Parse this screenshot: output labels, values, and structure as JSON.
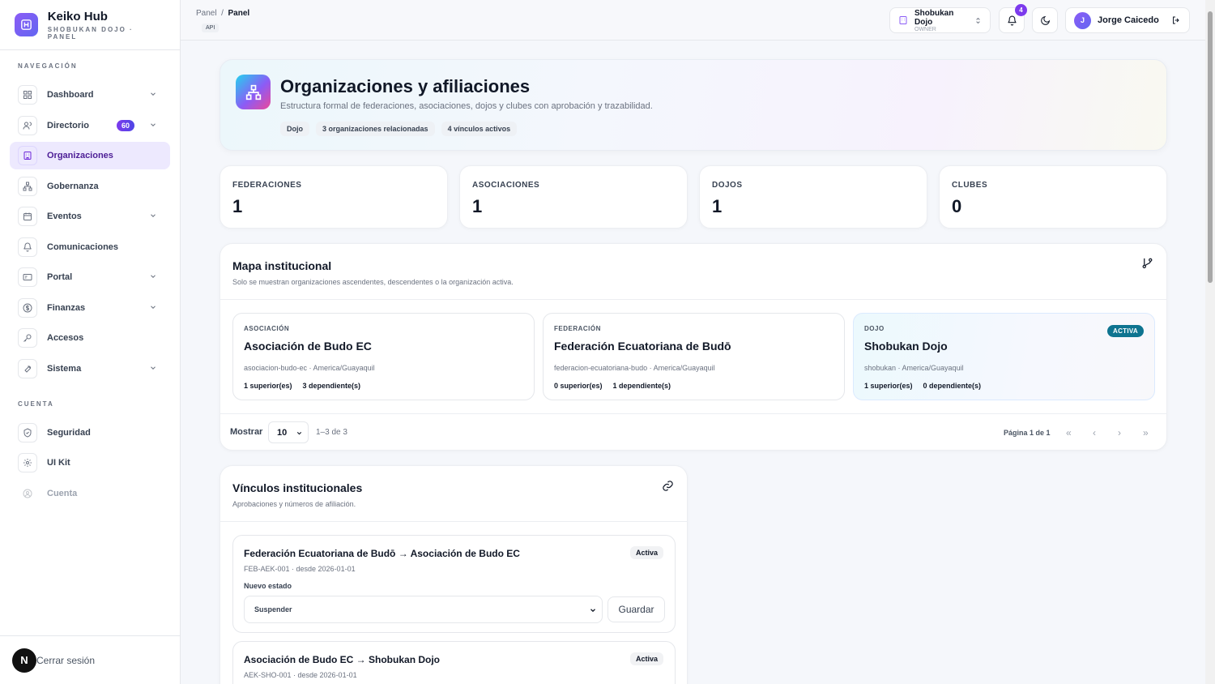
{
  "brand": {
    "title": "Keiko Hub",
    "subtitle": "SHOBUKAN DOJO · PANEL"
  },
  "sidebar": {
    "nav_label": "NAVEGACIÓN",
    "items": [
      {
        "label": "Dashboard",
        "icon": "grid-icon",
        "chevron": true
      },
      {
        "label": "Directorio",
        "icon": "users-icon",
        "chevron": true,
        "badge": "60"
      },
      {
        "label": "Organizaciones",
        "icon": "building-icon",
        "active": true
      },
      {
        "label": "Gobernanza",
        "icon": "network-icon"
      },
      {
        "label": "Eventos",
        "icon": "calendar-icon",
        "chevron": true
      },
      {
        "label": "Comunicaciones",
        "icon": "bell-icon"
      },
      {
        "label": "Portal",
        "icon": "card-icon",
        "chevron": true
      },
      {
        "label": "Finanzas",
        "icon": "dollar-icon",
        "chevron": true
      },
      {
        "label": "Accesos",
        "icon": "key-icon"
      },
      {
        "label": "Sistema",
        "icon": "wrench-icon",
        "chevron": true
      }
    ],
    "account_label": "CUENTA",
    "account_items": [
      {
        "label": "Seguridad",
        "icon": "shield-icon"
      },
      {
        "label": "UI Kit",
        "icon": "gear-icon"
      },
      {
        "label": "Cuenta",
        "icon": "user-circle-icon",
        "disabled": true
      }
    ],
    "logout": {
      "initial": "N",
      "label": "Cerrar sesión"
    }
  },
  "topbar": {
    "crumb_root": "Panel",
    "crumb_sep": "/",
    "crumb_current": "Panel",
    "api_tag": "API",
    "org_name": "Shobukan Dojo",
    "org_role": "OWNER",
    "notif_count": "4",
    "user_initial": "J",
    "user_name": "Jorge Caicedo"
  },
  "hero": {
    "title": "Organizaciones y afiliaciones",
    "description": "Estructura formal de federaciones, asociaciones, dojos y clubes con aprobación y trazabilidad.",
    "chips": [
      "Dojo",
      "3 organizaciones relacionadas",
      "4 vínculos activos"
    ]
  },
  "stats": [
    {
      "label": "FEDERACIONES",
      "value": "1"
    },
    {
      "label": "ASOCIACIONES",
      "value": "1"
    },
    {
      "label": "DOJOS",
      "value": "1"
    },
    {
      "label": "CLUBES",
      "value": "0"
    }
  ],
  "map": {
    "title": "Mapa institucional",
    "subtitle": "Solo se muestran organizaciones ascendentes, descendentes o la organización activa.",
    "cards": [
      {
        "type": "ASOCIACIÓN",
        "name": "Asociación de Budo EC",
        "meta": "asociacion-budo-ec · America/Guayaquil",
        "superiors": "1 superior(es)",
        "dependents": "3 dependiente(s)"
      },
      {
        "type": "FEDERACIÓN",
        "name": "Federación Ecuatoriana de Budō",
        "meta": "federacion-ecuatoriana-budo · America/Guayaquil",
        "superiors": "0 superior(es)",
        "dependents": "1 dependiente(s)"
      },
      {
        "type": "DOJO",
        "name": "Shobukan Dojo",
        "meta": "shobukan · America/Guayaquil",
        "superiors": "1 superior(es)",
        "dependents": "0 dependiente(s)",
        "badge": "ACTIVA"
      }
    ],
    "pager": {
      "show_label": "Mostrar",
      "page_size": "10",
      "range": "1–3 de 3",
      "page_info": "Página 1 de 1"
    }
  },
  "links": {
    "title": "Vínculos institucionales",
    "subtitle": "Aprobaciones y números de afiliación.",
    "items": [
      {
        "title": "Federación Ecuatoriana de Budō → Asociación de Budo EC",
        "meta": "FEB-AEK-001 · desde 2026-01-01",
        "status": "Activa",
        "state_label": "Nuevo estado",
        "state_value": "Suspender",
        "save_label": "Guardar"
      },
      {
        "title": "Asociación de Budo EC → Shobukan Dojo",
        "meta": "AEK-SHO-001 · desde 2026-01-01",
        "status": "Activa"
      }
    ]
  },
  "colors": {
    "accent": "#7c3aed",
    "active_badge": "#0e7490",
    "active_nav_bg": "#ede9fe"
  }
}
